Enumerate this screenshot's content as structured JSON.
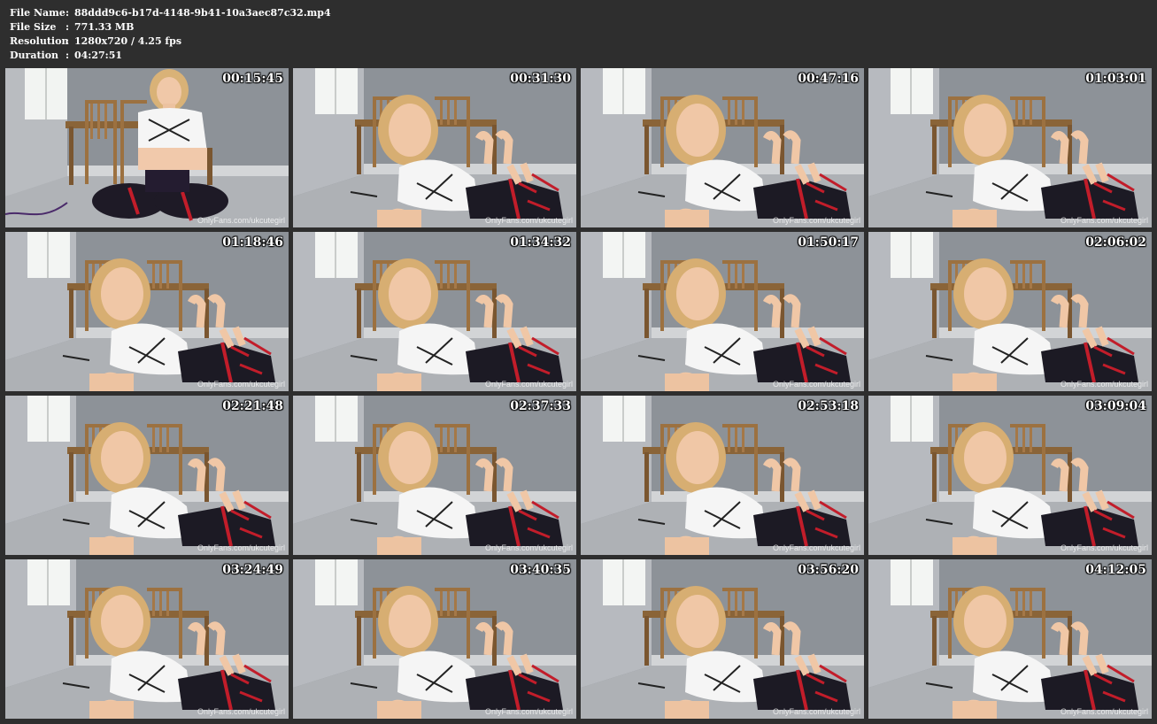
{
  "info": {
    "rows": [
      {
        "label": "File Name",
        "sep": ":",
        "value": "88ddd9c6-b17d-4148-9b41-10a3aec87c32.mp4"
      },
      {
        "label": "File Size",
        "sep": ":",
        "value": "771.33 MB"
      },
      {
        "label": "Resolution",
        "sep": ":",
        "value": "1280x720 / 4.25 fps"
      },
      {
        "label": "Duration",
        "sep": ":",
        "value": "04:27:51"
      }
    ]
  },
  "thumbnails": [
    {
      "time": "00:15:45",
      "watermark": "OnlyFans.com/ukcutegirl",
      "pose": "sitting"
    },
    {
      "time": "00:31:30",
      "watermark": "OnlyFans.com/ukcutegirl",
      "pose": "lying"
    },
    {
      "time": "00:47:16",
      "watermark": "OnlyFans.com/ukcutegirl",
      "pose": "lying"
    },
    {
      "time": "01:03:01",
      "watermark": "OnlyFans.com/ukcutegirl",
      "pose": "lying"
    },
    {
      "time": "01:18:46",
      "watermark": "OnlyFans.com/ukcutegirl",
      "pose": "lying"
    },
    {
      "time": "01:34:32",
      "watermark": "OnlyFans.com/ukcutegirl",
      "pose": "lying"
    },
    {
      "time": "01:50:17",
      "watermark": "OnlyFans.com/ukcutegirl",
      "pose": "lying"
    },
    {
      "time": "02:06:02",
      "watermark": "OnlyFans.com/ukcutegirl",
      "pose": "lying"
    },
    {
      "time": "02:21:48",
      "watermark": "OnlyFans.com/ukcutegirl",
      "pose": "lying"
    },
    {
      "time": "02:37:33",
      "watermark": "OnlyFans.com/ukcutegirl",
      "pose": "lying"
    },
    {
      "time": "02:53:18",
      "watermark": "OnlyFans.com/ukcutegirl",
      "pose": "lying"
    },
    {
      "time": "03:09:04",
      "watermark": "OnlyFans.com/ukcutegirl",
      "pose": "lying"
    },
    {
      "time": "03:24:49",
      "watermark": "OnlyFans.com/ukcutegirl",
      "pose": "lying"
    },
    {
      "time": "03:40:35",
      "watermark": "OnlyFans.com/ukcutegirl",
      "pose": "lying"
    },
    {
      "time": "03:56:20",
      "watermark": "OnlyFans.com/ukcutegirl",
      "pose": "lying"
    },
    {
      "time": "04:12:05",
      "watermark": "OnlyFans.com/ukcutegirl",
      "pose": "lying"
    }
  ]
}
